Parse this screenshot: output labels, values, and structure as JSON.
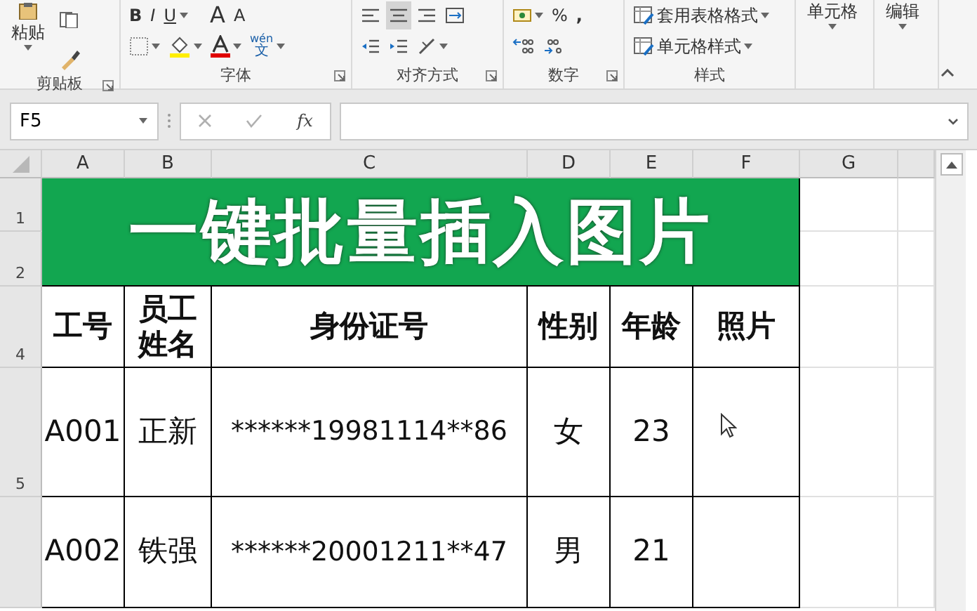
{
  "ribbon": {
    "groups": [
      {
        "kind": "clipboard",
        "label": "剪贴板",
        "paste": "粘贴"
      },
      {
        "kind": "font",
        "label": "字体",
        "bold": "B",
        "italic": "I",
        "underline": "U",
        "grow": "A",
        "shrink": "A",
        "phonetic_top": "wén",
        "phonetic_bottom": "文"
      },
      {
        "kind": "alignment",
        "label": "对齐方式"
      },
      {
        "kind": "number",
        "label": "数字",
        "percent": "%",
        "comma": ","
      },
      {
        "kind": "styles",
        "label": "样式",
        "table_format": "套用表格格式",
        "cell_styles": "单元格样式"
      },
      {
        "kind": "cells",
        "button": "单元格"
      },
      {
        "kind": "editing",
        "button": "编辑"
      }
    ]
  },
  "formula_bar": {
    "name_box": "F5",
    "function_label": "fx"
  },
  "sheet": {
    "columns": [
      "A",
      "B",
      "C",
      "D",
      "E",
      "F",
      "G"
    ],
    "row_numbers": [
      "1",
      "2",
      "4",
      "5"
    ],
    "title": "一键批量插入图片",
    "headers": [
      "工号",
      "员工姓名",
      "身份证号",
      "性别",
      "年龄",
      "照片"
    ],
    "rows": [
      {
        "id": "A001",
        "name": "正新",
        "id_number": "******19981114**86",
        "gender": "女",
        "age": "23"
      },
      {
        "id": "A002",
        "name": "铁强",
        "id_number": "******20001211**47",
        "gender": "男",
        "age": "21"
      }
    ]
  }
}
